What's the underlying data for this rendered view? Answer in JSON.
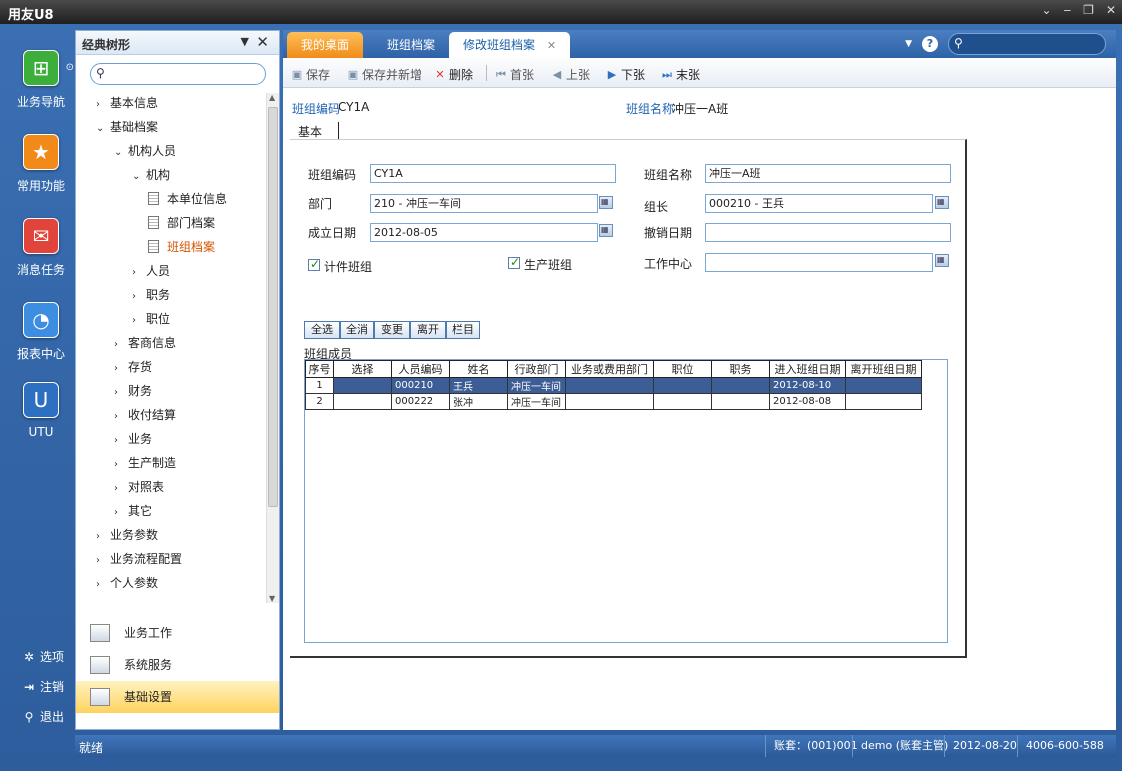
{
  "app": {
    "title": "用友U8"
  },
  "iconbar": {
    "items": [
      {
        "label": "业务导航",
        "icon": "business-navigation-icon",
        "color": "#3cae3c"
      },
      {
        "label": "常用功能",
        "icon": "star-icon",
        "color": "#f28a1a"
      },
      {
        "label": "消息任务",
        "icon": "mail-check-icon",
        "color": "#e0443a"
      },
      {
        "label": "报表中心",
        "icon": "report-chart-icon",
        "color": "#3d8de0"
      },
      {
        "label": "UTU",
        "icon": "utu-icon",
        "color": "#2d6fc0"
      }
    ],
    "bottom": [
      {
        "label": "选项",
        "icon": "gear-icon"
      },
      {
        "label": "注销",
        "icon": "logout-icon"
      },
      {
        "label": "退出",
        "icon": "exit-key-icon"
      }
    ]
  },
  "tree": {
    "title": "经典树形",
    "search_placeholder": "",
    "items": [
      {
        "label": "基本信息",
        "level": 0,
        "arrow": "›",
        "type": "folder"
      },
      {
        "label": "基础档案",
        "level": 0,
        "arrow": "⌄",
        "type": "folder"
      },
      {
        "label": "机构人员",
        "level": 1,
        "arrow": "⌄",
        "type": "folder"
      },
      {
        "label": "机构",
        "level": 2,
        "arrow": "⌄",
        "type": "folder"
      },
      {
        "label": "本单位信息",
        "level": 3,
        "arrow": "",
        "type": "doc"
      },
      {
        "label": "部门档案",
        "level": 3,
        "arrow": "",
        "type": "doc"
      },
      {
        "label": "班组档案",
        "level": 3,
        "arrow": "",
        "type": "doc",
        "selected": true
      },
      {
        "label": "人员",
        "level": 2,
        "arrow": "›",
        "type": "folder"
      },
      {
        "label": "职务",
        "level": 2,
        "arrow": "›",
        "type": "folder"
      },
      {
        "label": "职位",
        "level": 2,
        "arrow": "›",
        "type": "folder"
      },
      {
        "label": "客商信息",
        "level": 1,
        "arrow": "›",
        "type": "folder"
      },
      {
        "label": "存货",
        "level": 1,
        "arrow": "›",
        "type": "folder"
      },
      {
        "label": "财务",
        "level": 1,
        "arrow": "›",
        "type": "folder"
      },
      {
        "label": "收付结算",
        "level": 1,
        "arrow": "›",
        "type": "folder"
      },
      {
        "label": "业务",
        "level": 1,
        "arrow": "›",
        "type": "folder"
      },
      {
        "label": "生产制造",
        "level": 1,
        "arrow": "›",
        "type": "folder"
      },
      {
        "label": "对照表",
        "level": 1,
        "arrow": "›",
        "type": "folder"
      },
      {
        "label": "其它",
        "level": 1,
        "arrow": "›",
        "type": "folder"
      },
      {
        "label": "业务参数",
        "level": 0,
        "arrow": "›",
        "type": "folder"
      },
      {
        "label": "业务流程配置",
        "level": 0,
        "arrow": "›",
        "type": "folder"
      },
      {
        "label": "个人参数",
        "level": 0,
        "arrow": "›",
        "type": "folder"
      }
    ],
    "sections": [
      {
        "label": "业务工作",
        "icon": "business-work-icon"
      },
      {
        "label": "系统服务",
        "icon": "system-service-icon"
      },
      {
        "label": "基础设置",
        "icon": "basic-settings-icon",
        "active": true
      }
    ]
  },
  "tabs": [
    {
      "label": "我的桌面",
      "kind": "home"
    },
    {
      "label": "班组档案",
      "kind": "normal"
    },
    {
      "label": "修改班组档案",
      "kind": "active"
    }
  ],
  "toolbar": {
    "save": "保存",
    "save_new": "保存并新增",
    "delete": "删除",
    "first": "首张",
    "prev": "上张",
    "next": "下张",
    "last": "末张"
  },
  "header": {
    "code_label": "班组编码",
    "code_value": "CY1A",
    "name_label": "班组名称",
    "name_value": "冲压一A班",
    "sub_tab": "基本"
  },
  "form": {
    "code_label": "班组编码",
    "code_value": "CY1A",
    "name_label": "班组名称",
    "name_value": "冲压一A班",
    "dept_label": "部门",
    "dept_value": "210 - 冲压一车间",
    "leader_label": "组长",
    "leader_value": "000210 - 王兵",
    "setup_label": "成立日期",
    "setup_value": "2012-08-05",
    "cancel_label": "撤销日期",
    "cancel_value": "",
    "piece_label": "计件班组",
    "prod_label": "生产班组",
    "workcenter_label": "工作中心",
    "workcenter_value": ""
  },
  "grid_buttons": [
    "全选",
    "全消",
    "变更",
    "离开",
    "栏目"
  ],
  "members": {
    "label": "班组成员",
    "columns": [
      "序号",
      "选择",
      "人员编码",
      "姓名",
      "行政部门",
      "业务或费用部门",
      "职位",
      "职务",
      "进入班组日期",
      "离开班组日期"
    ],
    "rows": [
      [
        "1",
        "",
        "000210",
        "王兵",
        "冲压一车间",
        "",
        "",
        "",
        "2012-08-10",
        ""
      ],
      [
        "2",
        "",
        "000222",
        "张冲",
        "冲压一车间",
        "",
        "",
        "",
        "2012-08-08",
        ""
      ]
    ]
  },
  "status": {
    "text": "就绪",
    "account": "账套：(001)001",
    "user": "demo (账套主管)",
    "date": "2012-08-20",
    "phone": "4006-600-588"
  },
  "colors": {
    "accent": "#2f63a8",
    "home_tab": "#f08c1a",
    "selected_row": "#3c5d95"
  }
}
